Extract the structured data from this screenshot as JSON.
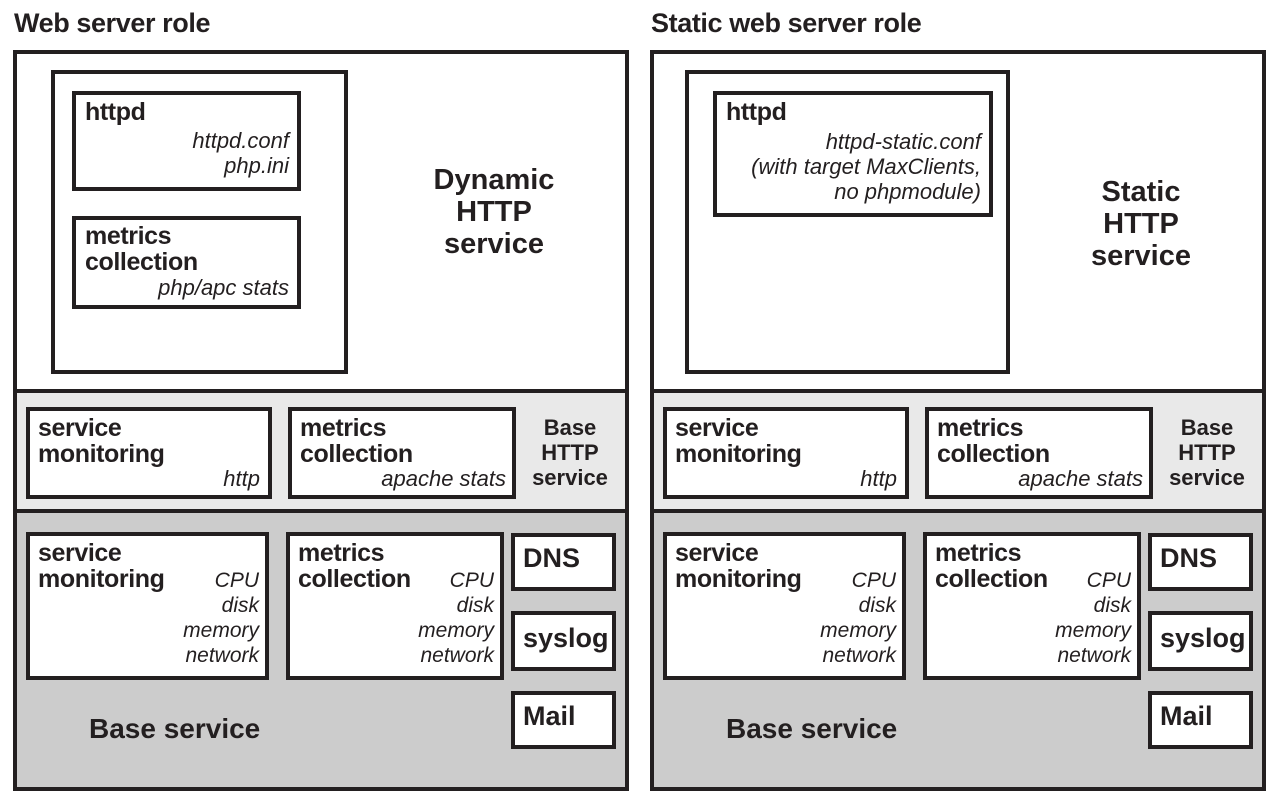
{
  "diagram": {
    "title_left": "Web server role",
    "title_right": "Static web server role"
  },
  "left_panel": {
    "title": "Web server role",
    "service_label": "Dynamic\nHTTP\nservice",
    "httpd": {
      "name": "httpd",
      "config": "httpd.conf\nphp.ini"
    },
    "metrics": {
      "name": "metrics\ncollection",
      "config": "php/apc stats"
    },
    "http_band": {
      "label": "Base\nHTTP\nservice",
      "service_monitoring": {
        "name": "service\nmonitoring",
        "items": "http"
      },
      "metrics_collection": {
        "name": "metrics\ncollection",
        "items": "apache stats"
      }
    },
    "base_band": {
      "label": "Base service",
      "service_monitoring": {
        "name": "service\nmonitoring",
        "items": "CPU\ndisk\nmemory\nnetwork"
      },
      "metrics_collection": {
        "name": "metrics\ncollection",
        "items": "CPU\ndisk\nmemory\nnetwork"
      },
      "side_boxes": [
        {
          "label": "DNS"
        },
        {
          "label": "syslog"
        },
        {
          "label": "Mail"
        }
      ]
    }
  },
  "right_panel": {
    "title": "Static web server role",
    "service_label": "Static\nHTTP\nservice",
    "httpd": {
      "name": "httpd",
      "config": "httpd-static.conf\n(with target MaxClients,\nno phpmodule)"
    },
    "http_band": {
      "label": "Base\nHTTP\nservice",
      "service_monitoring": {
        "name": "service\nmonitoring",
        "items": "http"
      },
      "metrics_collection": {
        "name": "metrics\ncollection",
        "items": "apache stats"
      }
    },
    "base_band": {
      "label": "Base service",
      "service_monitoring": {
        "name": "service\nmonitoring",
        "items": "CPU\ndisk\nmemory\nnetwork"
      },
      "metrics_collection": {
        "name": "metrics\ncollection",
        "items": "CPU\ndisk\nmemory\nnetwork"
      },
      "side_boxes": [
        {
          "label": "DNS"
        },
        {
          "label": "syslog"
        },
        {
          "label": "Mail"
        }
      ]
    }
  },
  "colors": {
    "ink": "#231f20",
    "band_http_bg": "#e9e9e9",
    "band_base_bg": "#cccccc",
    "box_bg": "#ffffff"
  }
}
